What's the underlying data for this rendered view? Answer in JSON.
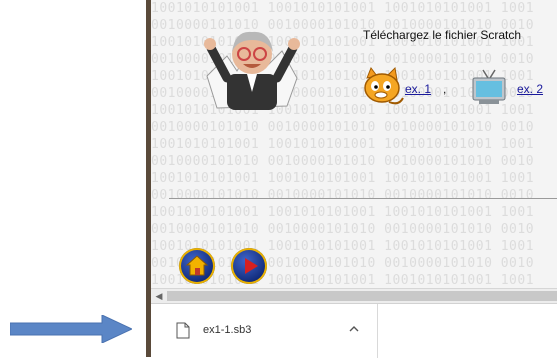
{
  "page": {
    "intro_text": "Téléchargez le fichier Scratch",
    "links": [
      {
        "label": "ex. 1",
        "separator": ","
      },
      {
        "label": "ex. 2"
      }
    ],
    "binary_rows": [
      "1001010101001 1001010101001 1001010101001 1001",
      "0010000101010 0010000101010 0010000101010 0010",
      "1001010101001 1001010101001 1001010101001 1001",
      "0010000101010 0010000101010 0010000101010 0010",
      "1001010101001 1001010101001 1001010101001 1001",
      "0010000101010 0010000101010 0010000101010 0010",
      "1001010101001 1001010101001 1001010101001 1001",
      "0010000101010 0010000101010 0010000101010 0010",
      "1001010101001 1001010101001 1001010101001 1001",
      "0010000101010 0010000101010 0010000101010 0010",
      "1001010101001 1001010101001 1001010101001 1001",
      "0010000101010 0010000101010 0010000101010 0010",
      "1001010101001 1001010101001 1001010101001 1001",
      "0010000101010 0010000101010 0010000101010 0010",
      "1001010101001 1001010101001 1001010101001 1001",
      "0010000101010 0010000101010 0010000101010 0010",
      "1001010101001 1001010101001 1001010101001 1001"
    ]
  },
  "icons": {
    "avatar": "avatar-icon",
    "scratch_cat": "scratch-cat-icon",
    "tv": "tv-icon",
    "home": "home-icon",
    "play": "play-icon",
    "file": "file-icon",
    "chevron": "chevron-up-icon",
    "arrow": "arrow-right-icon"
  },
  "download_bar": {
    "items": [
      {
        "filename": "ex1-1.sb3"
      }
    ]
  },
  "colors": {
    "link": "#1a1a9c",
    "nav_button": "#1f3f9e",
    "arrow": "#5b86c6"
  }
}
